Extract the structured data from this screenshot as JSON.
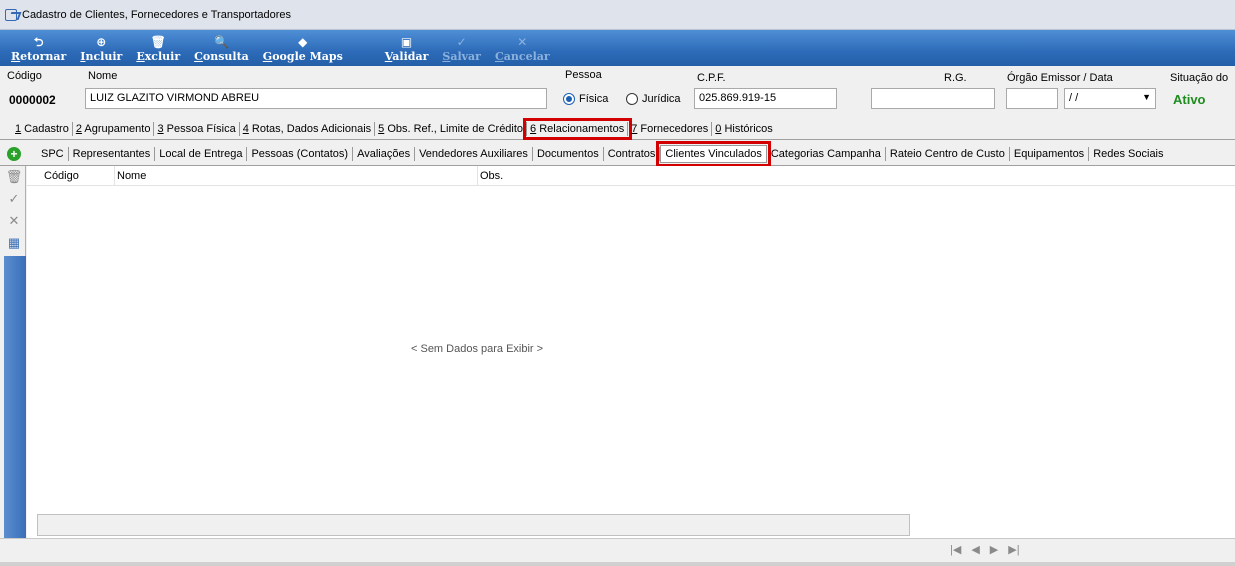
{
  "window": {
    "title": "Cadastro de Clientes, Fornecedores e Transportadores"
  },
  "toolbar": {
    "buttons": [
      {
        "label": "Retornar",
        "icon": "return-arrow-icon",
        "glyph": "⮌",
        "enabled": true
      },
      {
        "label": "Incluir",
        "icon": "plus-circle-icon",
        "glyph": "⊕",
        "enabled": true
      },
      {
        "label": "Excluir",
        "icon": "trash-icon",
        "glyph": "🗑",
        "enabled": true
      },
      {
        "label": "Consulta",
        "icon": "magnifier-icon",
        "glyph": "🔍",
        "enabled": true
      },
      {
        "label": "Google Maps",
        "icon": "map-pin-icon",
        "glyph": "◆",
        "enabled": true
      },
      {
        "label": "Validar",
        "icon": "validate-icon",
        "glyph": "▣",
        "enabled": true
      },
      {
        "label": "Salvar",
        "icon": "check-icon",
        "glyph": "✓",
        "enabled": false
      },
      {
        "label": "Cancelar",
        "icon": "x-icon",
        "glyph": "✕",
        "enabled": false
      }
    ]
  },
  "form": {
    "codigo_label": "Código",
    "codigo_value": "0000002",
    "nome_label": "Nome",
    "nome_value": "LUIZ GLAZITO VIRMOND ABREU",
    "pessoa_label": "Pessoa",
    "pessoa_fisica": "Física",
    "pessoa_juridica": "Jurídica",
    "cpf_label": "C.P.F.",
    "cpf_value": "025.869.919-15",
    "rg_label": "R.G.",
    "rg_value": "",
    "orgao_label": "Órgão Emissor  / Data",
    "orgao_value": "",
    "data_value": " / /",
    "situacao_label": "Situação do",
    "situacao_value": "Ativo",
    "situacao_color": "#1e8c1e"
  },
  "main_tabs": [
    {
      "key": "1",
      "label": " Cadastro"
    },
    {
      "key": "2",
      "label": " Agrupamento"
    },
    {
      "key": "3",
      "label": " Pessoa Física"
    },
    {
      "key": "4",
      "label": " Rotas, Dados Adicionais"
    },
    {
      "key": "5",
      "label": " Obs. Ref., Limite de Crédito"
    },
    {
      "key": "6",
      "label": " Relacionamentos"
    },
    {
      "key": "7",
      "label": " Fornecedores"
    },
    {
      "key": "0",
      "label": " Históricos"
    }
  ],
  "sub_tabs": [
    "SPC",
    "Representantes",
    "Local de Entrega",
    "Pessoas (Contatos)",
    "Avaliações",
    "Vendedores Auxiliares",
    "Documentos",
    "Contratos",
    "Clientes Vinculados",
    "Categorias Campanha",
    "Rateio Centro de Custo",
    "Equipamentos",
    "Redes Sociais"
  ],
  "grid": {
    "columns": [
      "Código",
      "Nome",
      "Obs."
    ],
    "empty_text": "< Sem Dados para Exibir >"
  },
  "status": {
    "nav": [
      "|◀",
      "◀",
      "▶",
      "▶|"
    ]
  }
}
